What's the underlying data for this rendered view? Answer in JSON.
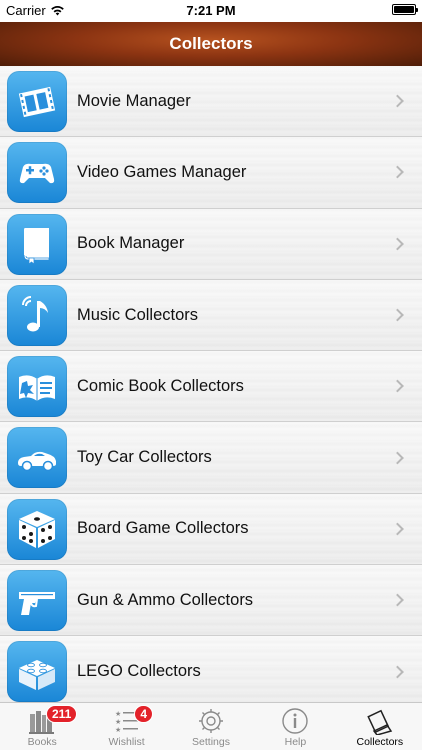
{
  "status_bar": {
    "carrier": "Carrier",
    "time": "7:21 PM",
    "wifi_icon": "wifi-icon",
    "battery_icon": "battery-icon"
  },
  "nav": {
    "title": "Collectors"
  },
  "collectors": [
    {
      "label": "Movie Manager",
      "icon": "film-strip-icon"
    },
    {
      "label": "Video Games Manager",
      "icon": "gamepad-icon"
    },
    {
      "label": "Book Manager",
      "icon": "book-icon"
    },
    {
      "label": "Music Collectors",
      "icon": "music-note-icon"
    },
    {
      "label": "Comic Book Collectors",
      "icon": "comic-book-icon"
    },
    {
      "label": "Toy Car Collectors",
      "icon": "toy-car-icon"
    },
    {
      "label": "Board Game Collectors",
      "icon": "dice-icon"
    },
    {
      "label": "Gun & Ammo Collectors",
      "icon": "pistol-icon"
    },
    {
      "label": "LEGO Collectors",
      "icon": "lego-brick-icon"
    }
  ],
  "tabs": [
    {
      "label": "Books",
      "icon": "books-icon",
      "badge": "211"
    },
    {
      "label": "Wishlist",
      "icon": "wishlist-icon",
      "badge": "4"
    },
    {
      "label": "Settings",
      "icon": "gear-icon",
      "badge": ""
    },
    {
      "label": "Help",
      "icon": "info-icon",
      "badge": ""
    },
    {
      "label": "Collectors",
      "icon": "collectors-icon",
      "badge": ""
    }
  ],
  "colors": {
    "accent_blue": "#1a86d6",
    "nav_brown": "#8c3412",
    "badge_red": "#e3222a"
  }
}
